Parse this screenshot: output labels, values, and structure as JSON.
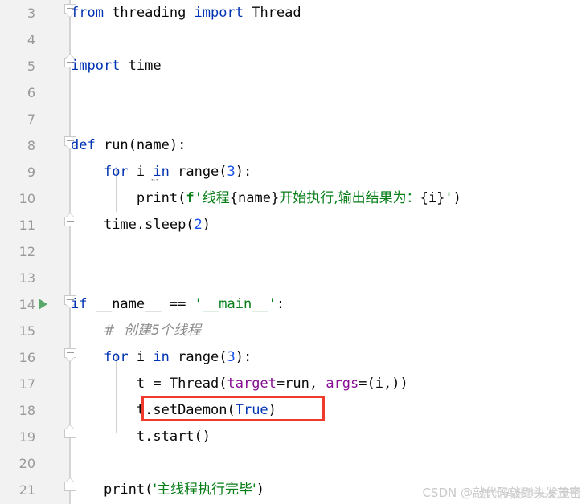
{
  "editor": {
    "language": "python",
    "first_visible_line": 3,
    "colors": {
      "background": "#ffffff",
      "gutter_background": "#f2f2f2",
      "line_number": "#999999",
      "keyword": "#0033b3",
      "number": "#1750eb",
      "string": "#067d17",
      "named_argument": "#871094",
      "comment": "#8c8c8c",
      "text": "#080808",
      "annotation_box": "#f03a2e",
      "run_marker": "#59a869"
    }
  },
  "lines": [
    {
      "no": "3",
      "text": "from threading import Thread"
    },
    {
      "no": "4",
      "text": ""
    },
    {
      "no": "5",
      "text": "import time"
    },
    {
      "no": "6",
      "text": ""
    },
    {
      "no": "7",
      "text": ""
    },
    {
      "no": "8",
      "text": "def run(name):"
    },
    {
      "no": "9",
      "text": "    for i in range(3):"
    },
    {
      "no": "10",
      "text": "        print(f'线程{name}开始执行,输出结果为：{i}')"
    },
    {
      "no": "11",
      "text": "    time.sleep(2)"
    },
    {
      "no": "12",
      "text": ""
    },
    {
      "no": "13",
      "text": ""
    },
    {
      "no": "14",
      "text": "if __name__ == '__main__':"
    },
    {
      "no": "15",
      "text": "    # 创建5个线程"
    },
    {
      "no": "16",
      "text": "    for i in range(3):"
    },
    {
      "no": "17",
      "text": "        t = Thread(target=run, args=(i,))"
    },
    {
      "no": "18",
      "text": "        t.setDaemon(True)"
    },
    {
      "no": "19",
      "text": "        t.start()"
    },
    {
      "no": "20",
      "text": ""
    },
    {
      "no": "21",
      "text": "    print('主线程执行完毕')"
    }
  ],
  "tokens": {
    "l3": {
      "kw_from": "from",
      "mod": " threading ",
      "kw_import": "import",
      "name": " Thread"
    },
    "l5": {
      "kw_import": "import",
      "mod": " time"
    },
    "l8": {
      "kw_def": "def",
      "sig": " run(name):"
    },
    "l9": {
      "indent": "    ",
      "kw_for": "for",
      "var": " i ",
      "kw_in": "in",
      "fn": " range(",
      "num": "3",
      "close": "):"
    },
    "l10": {
      "indent": "        ",
      "fn": "print(",
      "fprefix": "f",
      "quote_open": "'",
      "s1": "线程",
      "i1": "{name}",
      "s2": "开始执行,输出结果为：",
      "i2": "{i}",
      "quote_close": "'",
      "close": ")"
    },
    "l11": {
      "indent": "    ",
      "expr": "time.sleep(",
      "num": "2",
      "close": ")"
    },
    "l14": {
      "kw_if": "if",
      "name": " __name__ == ",
      "str": "'__main__'",
      "colon": ":"
    },
    "l15": {
      "indent": "    ",
      "comment": "#  创建5个线程"
    },
    "l16": {
      "indent": "    ",
      "kw_for": "for",
      "var": " i ",
      "kw_in": "in",
      "fn": " range(",
      "num": "3",
      "close": "):"
    },
    "l17": {
      "indent": "        ",
      "assign": "t = Thread(",
      "kwarg1": "target",
      "v1": "=run, ",
      "kwarg2": "args",
      "v2": "=(i,))"
    },
    "l18": {
      "indent": "        ",
      "call": "t.setDaemon(",
      "kw_true": "True",
      "close": ")"
    },
    "l19": {
      "indent": "        ",
      "call": "t.start()"
    },
    "l21": {
      "indent": "    ",
      "fn": "print(",
      "str": "'主线程执行完毕'",
      "close": ")"
    }
  },
  "gutter": {
    "fold_markers": [
      {
        "line": "3",
        "state": "expanded-start"
      },
      {
        "line": "5",
        "state": "block-end"
      },
      {
        "line": "8",
        "state": "expanded-start"
      },
      {
        "line": "11",
        "state": "block-end"
      },
      {
        "line": "14",
        "state": "expanded-start"
      },
      {
        "line": "16",
        "state": "expanded-start"
      },
      {
        "line": "19",
        "state": "block-end"
      },
      {
        "line": "21",
        "state": "block-end"
      }
    ],
    "run_marker_line": "14"
  },
  "annotation": {
    "type": "red-rectangle-highlight",
    "target_line": "18",
    "target_text": "t.setDaemon(True)"
  },
  "watermark": {
    "text": "CSDN @敲代码敲到头发茂密",
    "overlay_text": "敲代码敲到头发茂密"
  }
}
